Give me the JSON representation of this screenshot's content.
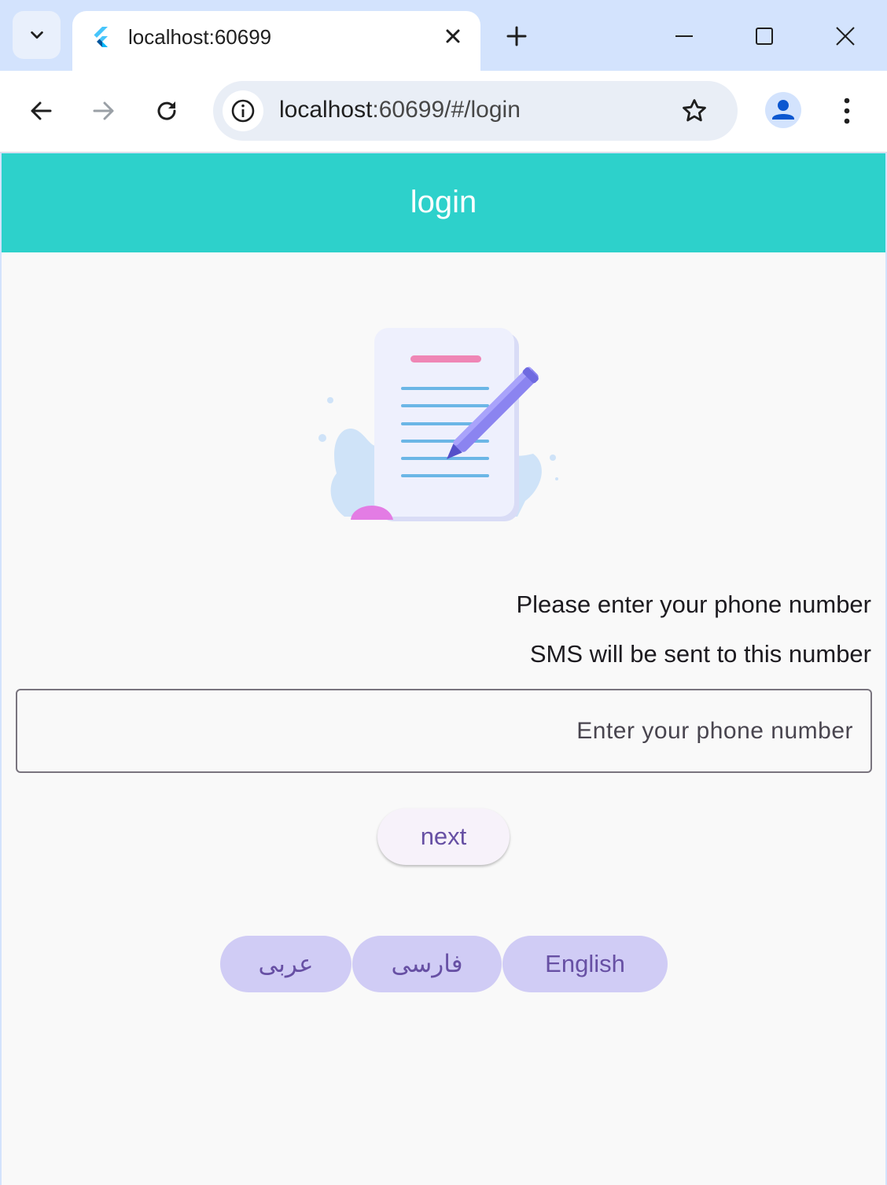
{
  "browser": {
    "tab_title": "localhost:60699",
    "url_host": "localhost",
    "url_rest": ":60699/#/login",
    "icons": {
      "tab_search": "chevron-down-icon",
      "favicon": "flutter-icon",
      "close_tab": "close-icon",
      "new_tab": "plus-icon",
      "minimize": "minimize-icon",
      "maximize": "maximize-icon",
      "close_window": "close-icon",
      "back": "arrow-left-icon",
      "forward": "arrow-right-icon",
      "reload": "reload-icon",
      "site_info": "info-icon",
      "bookmark": "star-icon",
      "profile": "person-icon",
      "menu": "more-vert-icon"
    }
  },
  "app": {
    "title": "login",
    "prompt_line1": "Please enter your phone number",
    "prompt_line2": "SMS will be sent to this number",
    "phone_input": {
      "placeholder": "Enter your phone number",
      "value": ""
    },
    "next_label": "next",
    "languages": [
      "عربی",
      "فارسی",
      "English"
    ],
    "colors": {
      "appbar": "#2dd1cb",
      "accent": "#6750a4",
      "language_button": "#d0ccf5"
    }
  }
}
